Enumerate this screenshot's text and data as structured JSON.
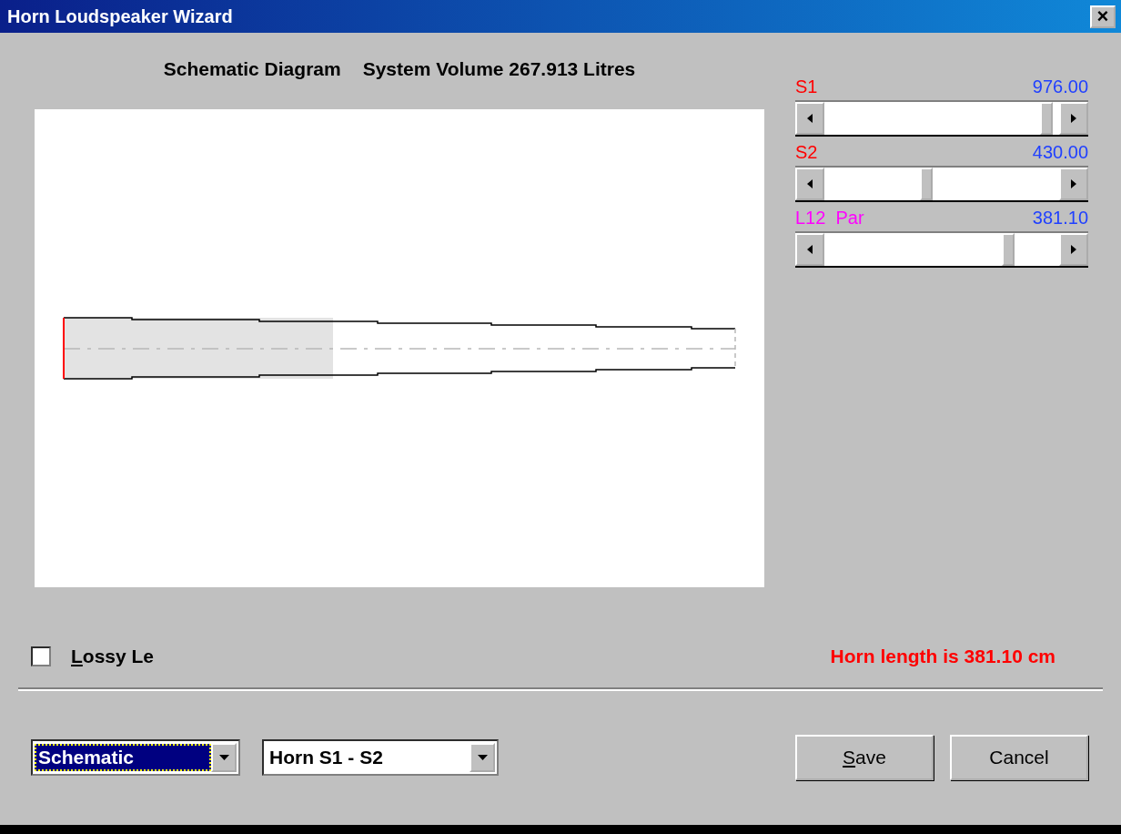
{
  "window": {
    "title": "Horn Loudspeaker Wizard",
    "close": "×"
  },
  "diagram": {
    "title": "Schematic Diagram",
    "volume": "System Volume 267.913 Litres"
  },
  "sliders": [
    {
      "name": "S1",
      "color": "#ff0000",
      "reading": "976.00",
      "level": 0.97
    },
    {
      "name": "S2",
      "color": "#ff0000",
      "reading": "430.00",
      "level": 0.43
    },
    {
      "name": "L12  Par",
      "color": "#ff00ff",
      "reading": "381.10",
      "level": 0.8
    }
  ],
  "lossy": {
    "label": "Lossy Le",
    "checked": false
  },
  "horn_length": "Horn length is 381.10 cm",
  "selects": [
    {
      "value": "Schematic",
      "focused": true
    },
    {
      "value": "Horn S1 - S2",
      "focused": false
    }
  ],
  "buttons": [
    "Save",
    "Cancel"
  ]
}
